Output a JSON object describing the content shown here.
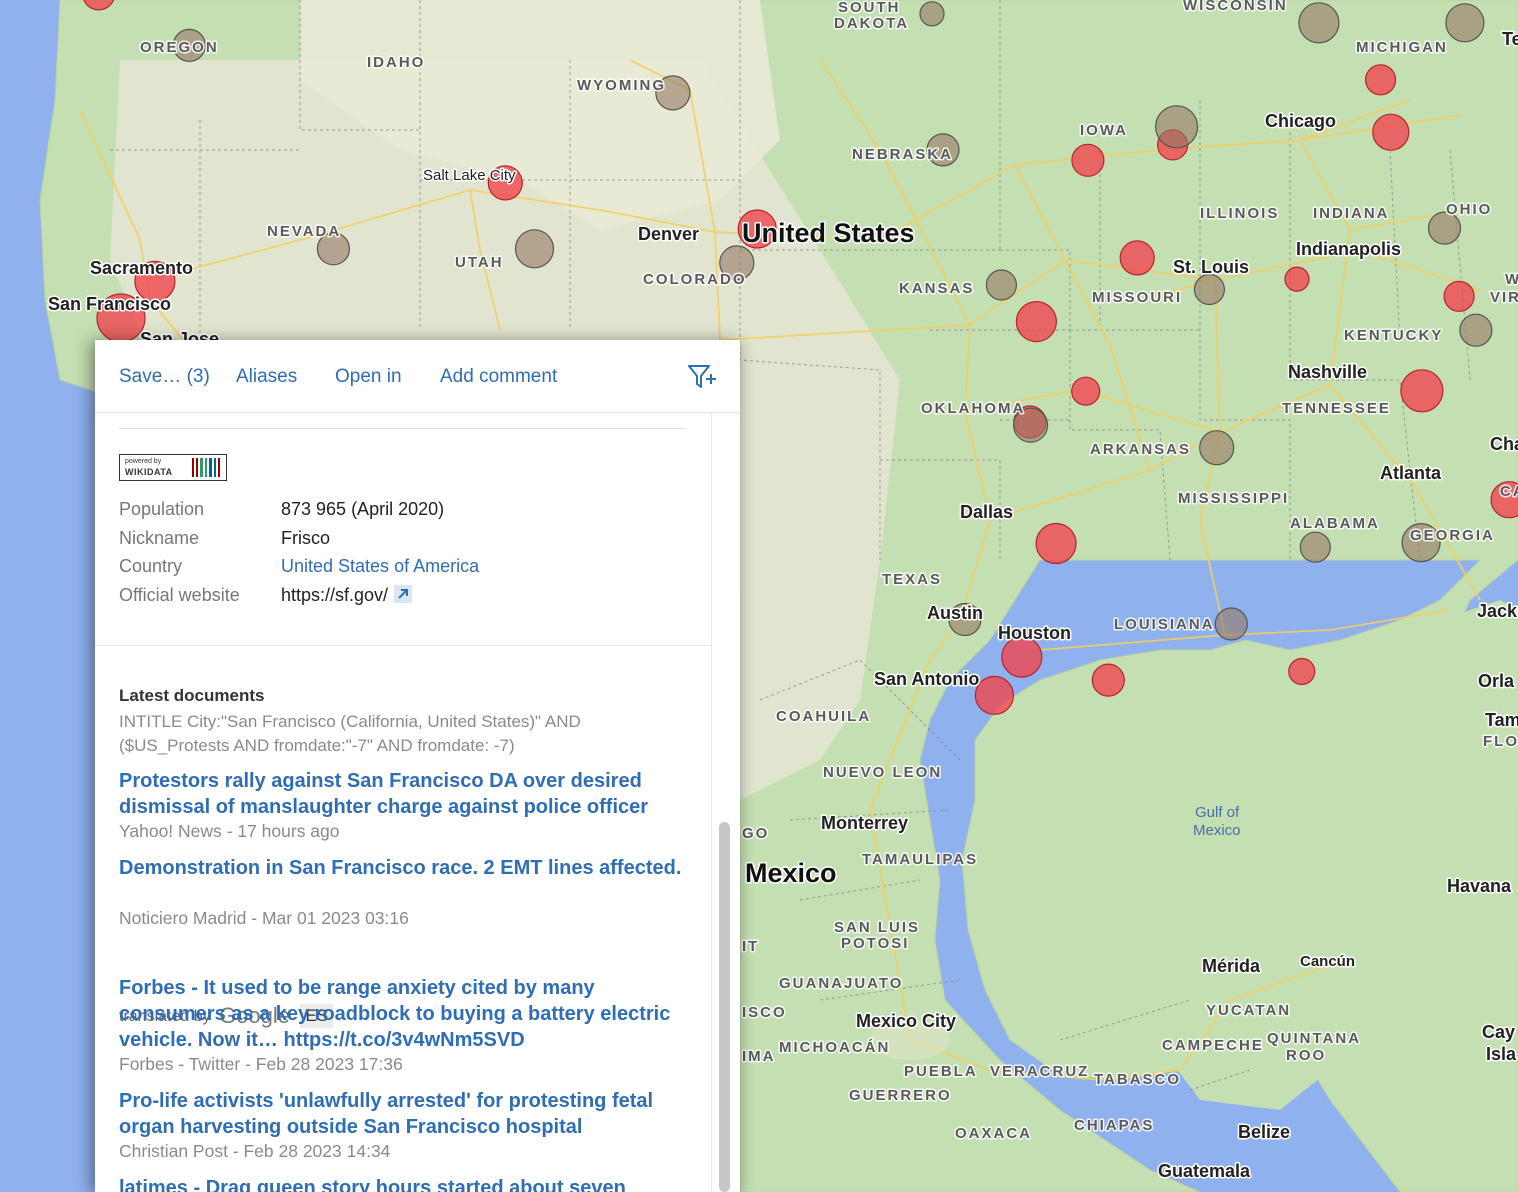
{
  "map": {
    "countries": [
      "United States",
      "Mexico"
    ],
    "water": [
      "Gulf of",
      "Mexico"
    ],
    "states": [
      "OREGON",
      "IDAHO",
      "WYOMING",
      "SOUTH",
      "DAKOTA",
      "WISCONSIN",
      "MICHIGAN",
      "NEBRASKA",
      "IOWA",
      "ILLINOIS",
      "INDIANA",
      "OHIO",
      "NEVADA",
      "UTAH",
      "COLORADO",
      "KANSAS",
      "MISSOURI",
      "KENTUCKY",
      "TENNESSEE",
      "OKLAHOMA",
      "ARKANSAS",
      "MISSISSIPPI",
      "ALABAMA",
      "GEORGIA",
      "TEXAS",
      "LOUISIANA",
      "COAHUILA",
      "NUEVO LEON",
      "TAMAULIPAS",
      "SAN LUIS",
      "POTOSI",
      "GUANAJUATO",
      "MICHOACÁN",
      "PUEBLA",
      "VERACRUZ",
      "TABASCO",
      "GUERRERO",
      "OAXACA",
      "CHIAPAS",
      "CAMPECHE",
      "YUCATAN",
      "QUINTANA",
      "ROO",
      "FLO"
    ],
    "cities": [
      "Chicago",
      "Salt Lake City",
      "Denver",
      "Sacramento",
      "San Francisco",
      "San Jose",
      "St. Louis",
      "Indianapolis",
      "Nashville",
      "Atlanta",
      "Dallas",
      "Austin",
      "Houston",
      "San Antonio",
      "Monterrey",
      "Mérida",
      "Cancún",
      "Mexico City",
      "Havana",
      "Belize",
      "Guatemala",
      "Jackso",
      "Orla",
      "Tam",
      "Cha",
      "Te",
      "Cay",
      "Isla",
      "ISCO",
      "IMA",
      "GO",
      "IT",
      "W",
      "VIR",
      "CA"
    ],
    "markers": [
      {
        "lat": 41.88,
        "lon": -87.63,
        "r": 18,
        "kind": "red"
      },
      {
        "lat": 40.76,
        "lon": -111.89,
        "r": 17,
        "kind": "red"
      },
      {
        "lat": 39.74,
        "lon": -104.99,
        "r": 19,
        "kind": "red"
      },
      {
        "lat": 37.77,
        "lon": -122.42,
        "r": 24,
        "kind": "red"
      },
      {
        "lat": 38.58,
        "lon": -121.49,
        "r": 20,
        "kind": "red"
      },
      {
        "lat": 32.78,
        "lon": -96.8,
        "r": 20,
        "kind": "red"
      },
      {
        "lat": 30.27,
        "lon": -97.74,
        "r": 20,
        "kind": "red"
      },
      {
        "lat": 29.42,
        "lon": -98.49,
        "r": 19,
        "kind": "red"
      },
      {
        "lat": 29.76,
        "lon": -95.37,
        "r": 16,
        "kind": "red"
      },
      {
        "lat": 33.75,
        "lon": -84.39,
        "r": 18,
        "kind": "red"
      },
      {
        "lat": 23.11,
        "lon": -82.37,
        "r": 12,
        "kind": "red"
      },
      {
        "lat": 39.1,
        "lon": -94.58,
        "r": 17,
        "kind": "red"
      },
      {
        "lat": 37.69,
        "lon": -97.34,
        "r": 20,
        "kind": "red"
      },
      {
        "lat": 36.15,
        "lon": -95.99,
        "r": 14,
        "kind": "red"
      },
      {
        "lat": 35.47,
        "lon": -97.52,
        "r": 16,
        "kind": "red"
      },
      {
        "lat": 36.16,
        "lon": -86.78,
        "r": 21,
        "kind": "red"
      },
      {
        "lat": 38.63,
        "lon": -90.2,
        "r": 12,
        "kind": "red"
      },
      {
        "lat": 38.25,
        "lon": -85.76,
        "r": 15,
        "kind": "red"
      },
      {
        "lat": 42.33,
        "lon": -83.05,
        "r": 18,
        "kind": "red"
      },
      {
        "lat": 41.5,
        "lon": -81.69,
        "r": 18,
        "kind": "red"
      },
      {
        "lat": 37.54,
        "lon": -77.44,
        "r": 18,
        "kind": "red"
      },
      {
        "lat": 43.04,
        "lon": -87.91,
        "r": 15,
        "kind": "red"
      },
      {
        "lat": 31.76,
        "lon": -106.49,
        "r": 24,
        "kind": "red"
      },
      {
        "lat": 29.95,
        "lon": -90.07,
        "r": 13,
        "kind": "red"
      },
      {
        "lat": 41.26,
        "lon": -95.93,
        "r": 16,
        "kind": "red"
      },
      {
        "lat": 41.6,
        "lon": -93.61,
        "r": 15,
        "kind": "red"
      },
      {
        "lat": 44.94,
        "lon": -123.03,
        "r": 16,
        "kind": "red"
      },
      {
        "lat": 39.76,
        "lon": -86.16,
        "r": 16,
        "kind": "grey"
      },
      {
        "lat": 43.8,
        "lon": -120.55,
        "r": 16,
        "kind": "grey"
      },
      {
        "lat": 42.75,
        "lon": -107.3,
        "r": 17,
        "kind": "grey"
      },
      {
        "lat": 41.49,
        "lon": -99.9,
        "r": 16,
        "kind": "grey"
      },
      {
        "lat": 39.3,
        "lon": -116.6,
        "r": 16,
        "kind": "grey"
      },
      {
        "lat": 39.3,
        "lon": -111.09,
        "r": 19,
        "kind": "grey"
      },
      {
        "lat": 38.99,
        "lon": -105.55,
        "r": 17,
        "kind": "grey"
      },
      {
        "lat": 38.5,
        "lon": -98.3,
        "r": 15,
        "kind": "grey"
      },
      {
        "lat": 38.4,
        "lon": -92.6,
        "r": 15,
        "kind": "grey"
      },
      {
        "lat": 37.5,
        "lon": -85.3,
        "r": 16,
        "kind": "grey"
      },
      {
        "lat": 35.4,
        "lon": -97.5,
        "r": 17,
        "kind": "grey"
      },
      {
        "lat": 34.9,
        "lon": -92.4,
        "r": 17,
        "kind": "grey"
      },
      {
        "lat": 32.7,
        "lon": -89.7,
        "r": 15,
        "kind": "grey"
      },
      {
        "lat": 32.8,
        "lon": -86.8,
        "r": 19,
        "kind": "grey"
      },
      {
        "lat": 32.6,
        "lon": -83.4,
        "r": 19,
        "kind": "grey"
      },
      {
        "lat": 31.1,
        "lon": -99.3,
        "r": 16,
        "kind": "grey"
      },
      {
        "lat": 31.0,
        "lon": -92.0,
        "r": 16,
        "kind": "grey"
      },
      {
        "lat": 42.0,
        "lon": -93.5,
        "r": 21,
        "kind": "grey"
      },
      {
        "lat": 44.3,
        "lon": -89.6,
        "r": 20,
        "kind": "grey"
      },
      {
        "lat": 44.3,
        "lon": -85.6,
        "r": 19,
        "kind": "grey"
      },
      {
        "lat": 40.4,
        "lon": -82.8,
        "r": 18,
        "kind": "grey"
      },
      {
        "lat": 44.5,
        "lon": -100.2,
        "r": 12,
        "kind": "grey"
      },
      {
        "lat": 28.1,
        "lon": -81.6,
        "r": 20,
        "kind": "grey"
      }
    ]
  },
  "toolbar": {
    "save": "Save… (3)",
    "aliases": "Aliases",
    "open_in": "Open in",
    "add_comment": "Add comment"
  },
  "wikidata": {
    "powered_by": "powered by",
    "name": "WIKIDATA"
  },
  "properties": [
    {
      "label": "Population",
      "value": "873 965 (April 2020)"
    },
    {
      "label": "Nickname",
      "value": "Frisco"
    },
    {
      "label": "Country",
      "value": "United States of America"
    },
    {
      "label": "Official website",
      "value": "https://sf.gov/"
    }
  ],
  "latest": {
    "title": "Latest documents",
    "query": "INTITLE City:\"San Francisco (California, United States)\" AND ($US_Protests AND fromdate:\"-7\" AND fromdate: -7)"
  },
  "documents": [
    {
      "title": "Protestors rally against San Francisco DA over desired dismissal of manslaughter charge against police officer",
      "meta": "Yahoo! News - 17 hours ago"
    },
    {
      "title": "Demonstration in San Francisco race. 2 EMT lines affected.",
      "meta": "Noticiero Madrid - Mar 01 2023 03:16"
    },
    {
      "title": "Forbes - It used to be range anxiety cited by many consumers as a key roadblock to buying a battery electric vehicle. Now it… https://t.co/3v4wNm5SVD",
      "meta": "Forbes - Twitter - Feb 28 2023 17:36"
    },
    {
      "title": "Pro-life activists 'unlawfully arrested' for protesting fetal organ harvesting outside San Francisco hospital",
      "meta": "Christian Post - Feb 28 2023 14:34"
    },
    {
      "title": "latimes - Drag queen story hours started about seven",
      "meta": ""
    }
  ],
  "translation": {
    "prefix": "translated by",
    "provider": "Google",
    "lang": "ES"
  }
}
